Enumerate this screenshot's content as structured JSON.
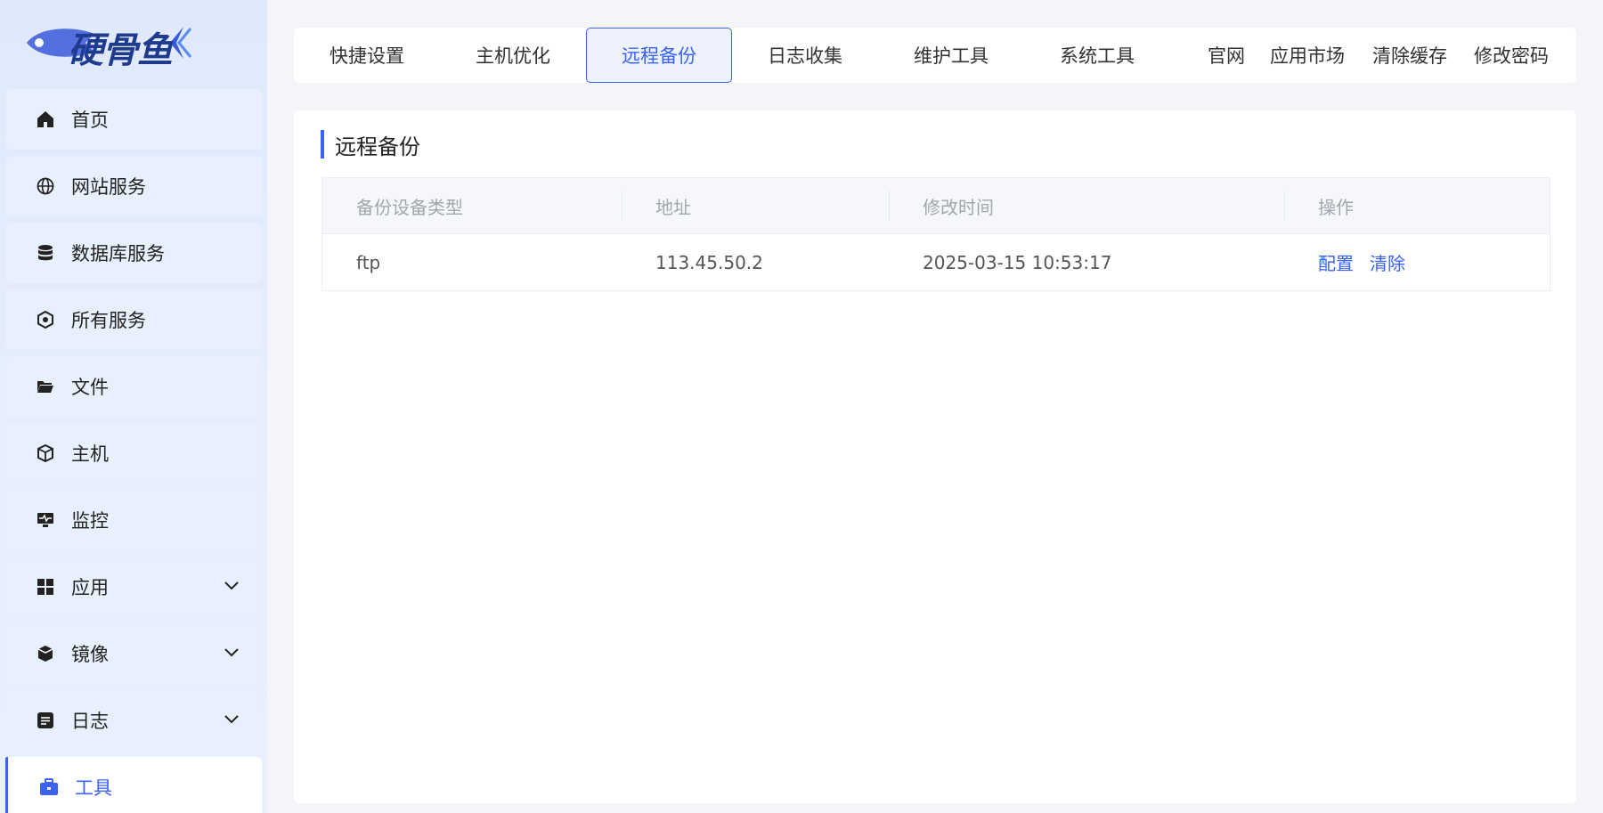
{
  "logo": {
    "text": "硬骨鱼"
  },
  "sidebar": {
    "items": [
      {
        "label": "首页"
      },
      {
        "label": "网站服务"
      },
      {
        "label": "数据库服务"
      },
      {
        "label": "所有服务"
      },
      {
        "label": "文件"
      },
      {
        "label": "主机"
      },
      {
        "label": "监控"
      },
      {
        "label": "应用"
      },
      {
        "label": "镜像"
      },
      {
        "label": "日志"
      },
      {
        "label": "工具"
      }
    ]
  },
  "topbar": {
    "tabs": [
      {
        "label": "快捷设置"
      },
      {
        "label": "主机优化"
      },
      {
        "label": "远程备份"
      },
      {
        "label": "日志收集"
      },
      {
        "label": "维护工具"
      },
      {
        "label": "系统工具"
      }
    ],
    "links": [
      {
        "label": "官网"
      },
      {
        "label": "应用市场"
      },
      {
        "label": "清除缓存"
      },
      {
        "label": "修改密码"
      }
    ]
  },
  "main": {
    "title": "远程备份",
    "table": {
      "headers": [
        "备份设备类型",
        "地址",
        "修改时间",
        "操作"
      ],
      "rows": [
        {
          "type": "ftp",
          "address": "113.45.50.2",
          "modified": "2025-03-15 10:53:17",
          "actions": [
            "配置",
            "清除"
          ]
        }
      ]
    }
  },
  "colors": {
    "accent": "#3a63f3",
    "sidebar_bg": "#e8f0fd",
    "page_bg": "#f3f5f9"
  }
}
